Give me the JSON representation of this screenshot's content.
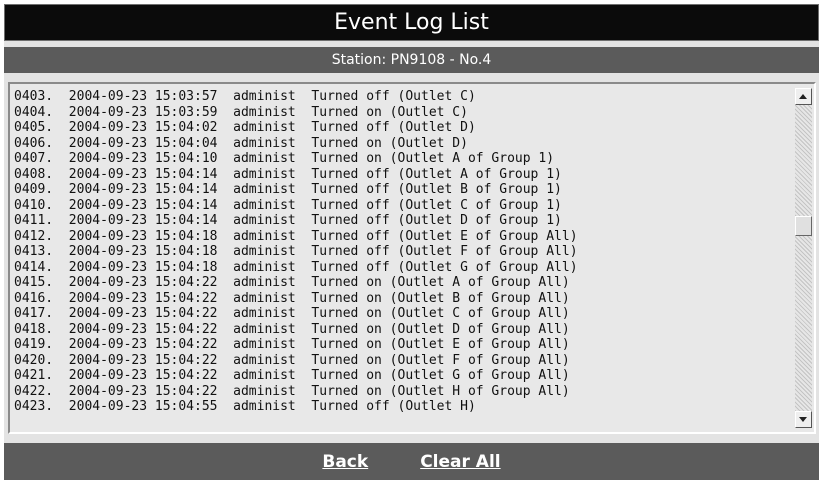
{
  "header": {
    "title": "Event Log List",
    "station": "Station: PN9108 - No.4"
  },
  "log": {
    "entries": [
      "0403.  2004-09-23 15:03:57  administ  Turned off (Outlet C)",
      "0404.  2004-09-23 15:03:59  administ  Turned on (Outlet C)",
      "0405.  2004-09-23 15:04:02  administ  Turned off (Outlet D)",
      "0406.  2004-09-23 15:04:04  administ  Turned on (Outlet D)",
      "0407.  2004-09-23 15:04:10  administ  Turned on (Outlet A of Group 1)",
      "0408.  2004-09-23 15:04:14  administ  Turned off (Outlet A of Group 1)",
      "0409.  2004-09-23 15:04:14  administ  Turned off (Outlet B of Group 1)",
      "0410.  2004-09-23 15:04:14  administ  Turned off (Outlet C of Group 1)",
      "0411.  2004-09-23 15:04:14  administ  Turned off (Outlet D of Group 1)",
      "0412.  2004-09-23 15:04:18  administ  Turned off (Outlet E of Group All)",
      "0413.  2004-09-23 15:04:18  administ  Turned off (Outlet F of Group All)",
      "0414.  2004-09-23 15:04:18  administ  Turned off (Outlet G of Group All)",
      "0415.  2004-09-23 15:04:22  administ  Turned on (Outlet A of Group All)",
      "0416.  2004-09-23 15:04:22  administ  Turned on (Outlet B of Group All)",
      "0417.  2004-09-23 15:04:22  administ  Turned on (Outlet C of Group All)",
      "0418.  2004-09-23 15:04:22  administ  Turned on (Outlet D of Group All)",
      "0419.  2004-09-23 15:04:22  administ  Turned on (Outlet E of Group All)",
      "0420.  2004-09-23 15:04:22  administ  Turned on (Outlet F of Group All)",
      "0421.  2004-09-23 15:04:22  administ  Turned on (Outlet G of Group All)",
      "0422.  2004-09-23 15:04:22  administ  Turned on (Outlet H of Group All)",
      "0423.  2004-09-23 15:04:55  administ  Turned off (Outlet H)"
    ]
  },
  "footer": {
    "back_label": "Back",
    "clear_all_label": "Clear All"
  },
  "icons": {
    "scroll_up": "scroll-up-arrow-icon",
    "scroll_down": "scroll-down-arrow-icon"
  },
  "colors": {
    "title_bg": "#0b0b0b",
    "bar_bg": "#5b5b5b",
    "panel_bg": "#e3e3e3"
  }
}
